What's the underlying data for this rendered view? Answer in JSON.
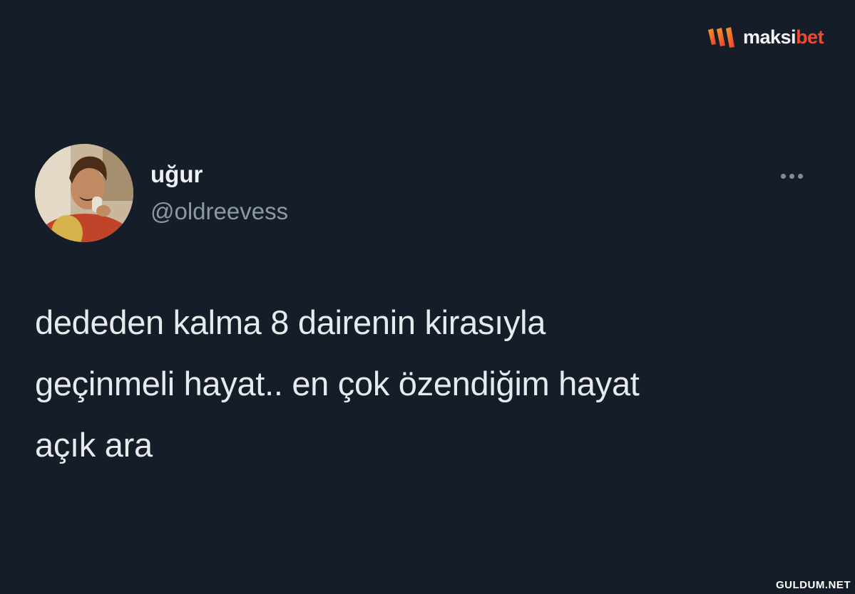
{
  "watermark": {
    "brand_part1": "maksi",
    "brand_part2": "bet",
    "icon": "maksibet-logo-icon",
    "accent_color": "#f04a32"
  },
  "tweet": {
    "author": {
      "display_name": "uğur",
      "handle": "@oldreevess",
      "avatar_icon": "profile-photo"
    },
    "more_icon": "more-horizontal-icon",
    "text_lines": [
      "dededen kalma 8 dairenin kirasıyla",
      "geçinmeli hayat.. en çok özendiğim hayat",
      "açık ara"
    ]
  },
  "site_credit": "GULDUM.NET",
  "colors": {
    "background": "#151d28",
    "primary_text": "#e6eaed",
    "secondary_text": "#8b98a5"
  }
}
